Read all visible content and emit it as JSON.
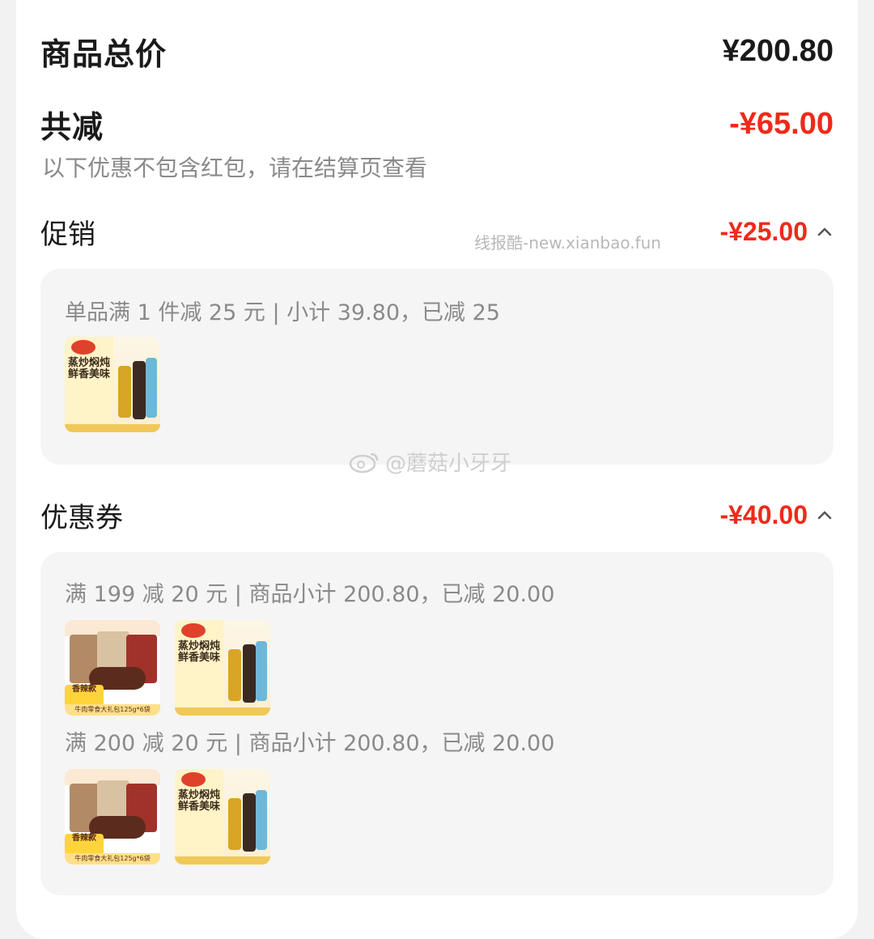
{
  "summary": {
    "total_label": "商品总价",
    "total_value": "¥200.80",
    "reduce_label": "共减",
    "reduce_value": "-¥65.00",
    "note": "以下优惠不包含红包，请在结算页查看"
  },
  "promotion": {
    "title": "促销",
    "amount": "-¥25.00",
    "rules": [
      {
        "text": "单品满 1 件减 25 元 | 小计 39.80，已减 25"
      }
    ]
  },
  "coupon": {
    "title": "优惠券",
    "amount": "-¥40.00",
    "rules": [
      {
        "text": "满 199 减 20 元 | 商品小计 200.80，已减 20.00"
      },
      {
        "text": "满 200 减 20 元 | 商品小计 200.80，已减 20.00"
      }
    ]
  },
  "products": {
    "sauce": {
      "brand_lines": "蒸炒焖炖\n鲜香美味"
    },
    "beef": {
      "tag": "香辣款",
      "bar": "牛肉零食大礼包125g*6袋"
    }
  },
  "watermarks": {
    "site": "线报酷-new.xianbao.fun",
    "weibo": "@蘑菇小牙牙"
  },
  "colors": {
    "accent_red": "#ee2a1b",
    "muted": "#8a8a8a",
    "panel": "#f5f5f5"
  }
}
